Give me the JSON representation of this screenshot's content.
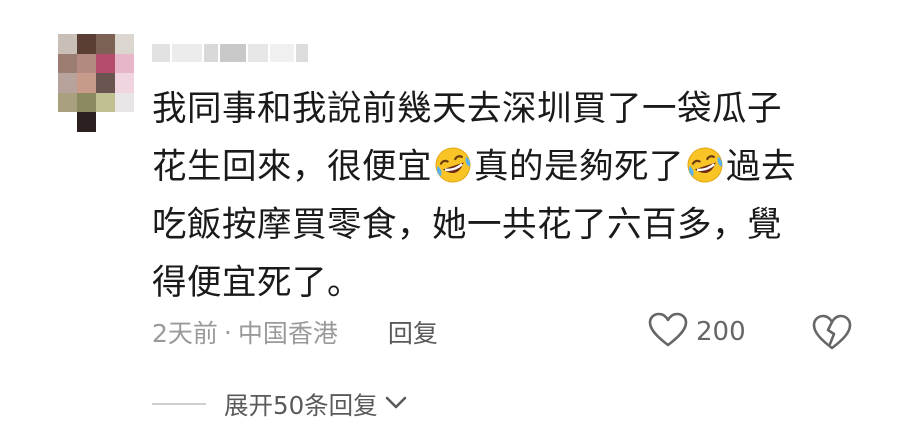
{
  "comment": {
    "avatar_icon": "user-avatar-pixelated",
    "username": "",
    "body_lines": [
      [
        "我同事和我說前幾天去深圳買了一袋瓜子"
      ],
      [
        "花生回來，很便宜",
        "真的是夠死了",
        "過去"
      ],
      [
        "吃飯按摩買零食，她一共花了六百多，覺"
      ],
      [
        "得便宜死了。"
      ]
    ],
    "emoji_name": "rolling-on-the-floor-laughing",
    "time": "2天前",
    "separator": "·",
    "location": "中国香港",
    "reply_label": "回复",
    "like_count": "200",
    "like_icon": "heart-outline-icon",
    "dislike_icon": "broken-heart-icon",
    "expand_label": "展开50条回复",
    "expand_icon": "chevron-down-icon"
  }
}
